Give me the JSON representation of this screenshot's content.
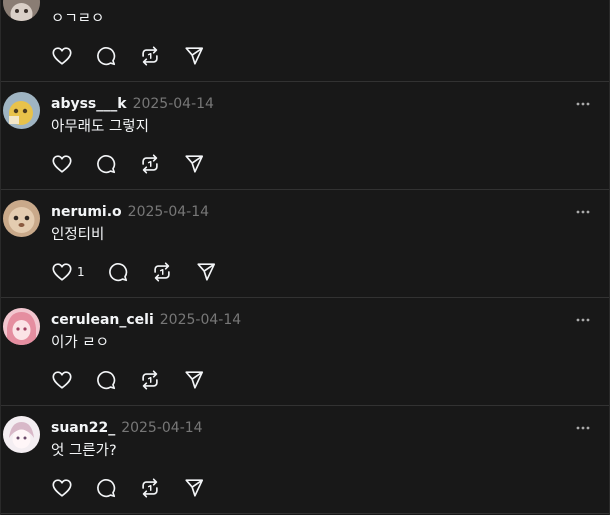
{
  "colors": {
    "background": "#181818",
    "text": "#f3f5f7",
    "muted": "#777777",
    "divider": "#323232"
  },
  "icons": {
    "like": "heart-icon",
    "reply": "comment-icon",
    "repost": "repost-icon",
    "share": "send-icon",
    "more": "more-icon"
  },
  "posts": [
    {
      "username": "",
      "date": "",
      "text": "ㅇㄱㄹㅇ",
      "like_count": ""
    },
    {
      "username": "abyss___k",
      "date": "2025-04-14",
      "text": "아무래도 그렇지",
      "like_count": ""
    },
    {
      "username": "nerumi.o",
      "date": "2025-04-14",
      "text": "인정티비",
      "like_count": "1"
    },
    {
      "username": "cerulean_celi",
      "date": "2025-04-14",
      "text": "이가 ㄹㅇ",
      "like_count": ""
    },
    {
      "username": "suan22_",
      "date": "2025-04-14",
      "text": "엇 그른가?",
      "like_count": ""
    }
  ]
}
